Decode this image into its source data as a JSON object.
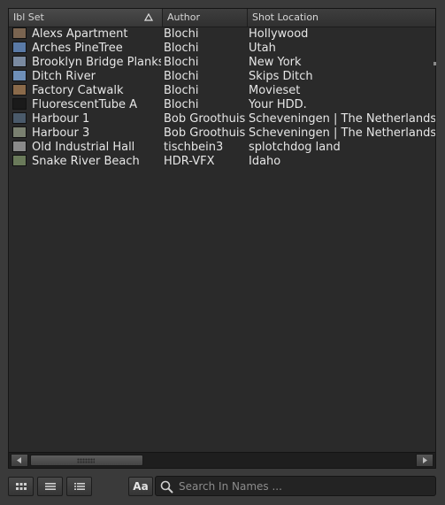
{
  "columns": [
    {
      "label": "Ibl Set",
      "sorted": true
    },
    {
      "label": "Author",
      "sorted": false
    },
    {
      "label": "Shot Location",
      "sorted": false
    }
  ],
  "rows": [
    {
      "name": "Alexs Apartment",
      "author": "Blochi",
      "location": "Hollywood",
      "thumb": "#7a6450"
    },
    {
      "name": "Arches PineTree",
      "author": "Blochi",
      "location": "Utah",
      "thumb": "#5a7aa6"
    },
    {
      "name": "Brooklyn Bridge Planks",
      "author": "Blochi",
      "location": "New York",
      "thumb": "#7a8aa0"
    },
    {
      "name": "Ditch River",
      "author": "Blochi",
      "location": "Skips Ditch",
      "thumb": "#6e8fb8"
    },
    {
      "name": "Factory Catwalk",
      "author": "Blochi",
      "location": "Movieset",
      "thumb": "#8a6a4a"
    },
    {
      "name": "FluorescentTube A",
      "author": "Blochi",
      "location": "Your HDD.",
      "thumb": "#1a1a1a"
    },
    {
      "name": "Harbour 1",
      "author": "Bob Groothuis",
      "location": "Scheveningen | The Netherlands",
      "thumb": "#4a5a6a"
    },
    {
      "name": "Harbour 3",
      "author": "Bob Groothuis",
      "location": "Scheveningen | The Netherlands",
      "thumb": "#7a8070"
    },
    {
      "name": "Old Industrial Hall",
      "author": "tischbein3",
      "location": "splotchdog land",
      "thumb": "#8a8a8a"
    },
    {
      "name": "Snake River Beach",
      "author": "HDR-VFX",
      "location": "Idaho",
      "thumb": "#6a7a5a"
    }
  ],
  "toolbar": {
    "case_label": "Aa",
    "search_placeholder": "Search In Names ..."
  }
}
